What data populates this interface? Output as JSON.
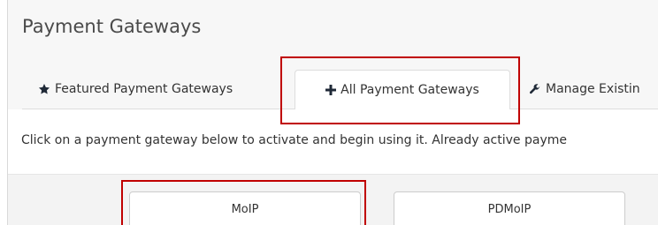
{
  "page": {
    "title": "Payment Gateways"
  },
  "tabs": [
    {
      "label": "Featured Payment Gateways",
      "icon": "star-icon",
      "active": false
    },
    {
      "label": "All Payment Gateways",
      "icon": "plus-icon",
      "active": true
    },
    {
      "label": "Manage Existin",
      "icon": "wrench-icon",
      "active": false
    }
  ],
  "intro": {
    "text": "Click on a payment gateway below to activate and begin using it. Already active payme"
  },
  "gateways": [
    {
      "label": "MoIP"
    },
    {
      "label": "PDMoIP"
    }
  ],
  "colors": {
    "highlight": "#c00000",
    "page_background": "#f7f7f7",
    "tab_border": "#dddddd"
  }
}
